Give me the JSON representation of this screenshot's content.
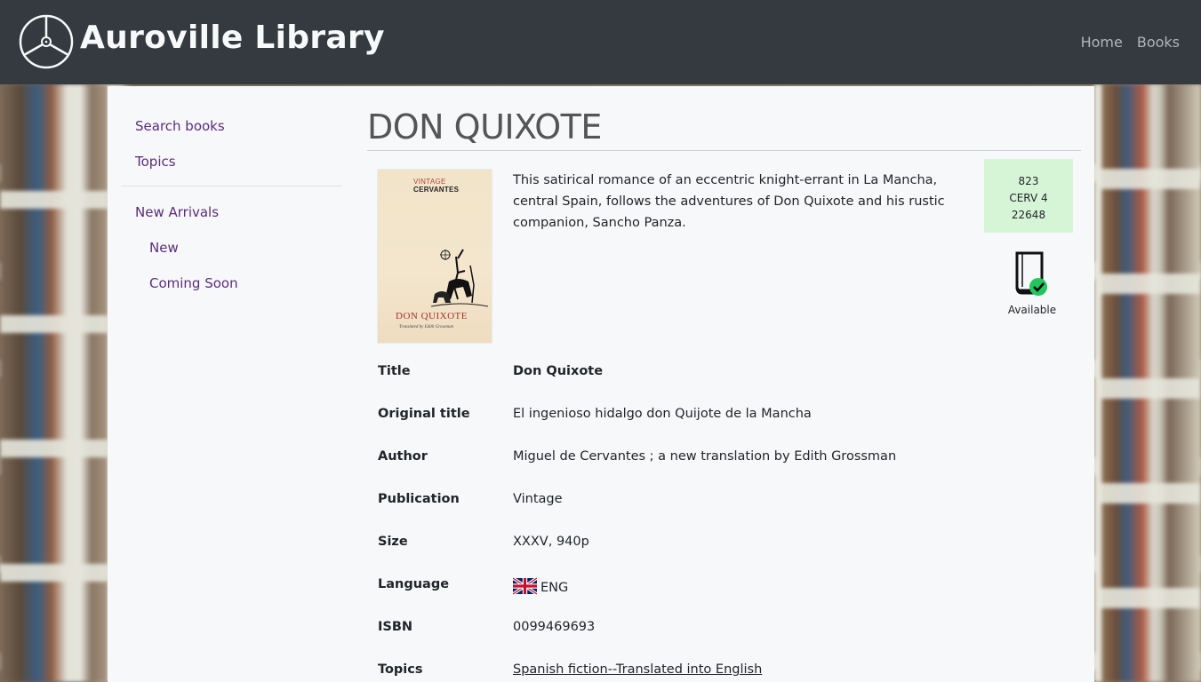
{
  "header": {
    "brand": "Auroville Library",
    "nav": [
      {
        "label": "Home"
      },
      {
        "label": "Books"
      }
    ]
  },
  "sidebar": {
    "items": [
      {
        "label": "Search books"
      },
      {
        "label": "Topics"
      },
      {
        "label": "New Arrivals"
      },
      {
        "label": "New"
      },
      {
        "label": "Coming Soon"
      }
    ]
  },
  "book": {
    "heading": "DON QUIXOTE",
    "cover": {
      "publisher_label": "VINTAGE",
      "author_label": "CERVANTES",
      "title": "DON QUIXOTE",
      "subtitle": "Translated by Edith Grossman"
    },
    "description": "This satirical romance of an eccentric knight-errant in La Mancha, central Spain, follows the adventures of Don Quixote and his rustic companion, Sancho Panza.",
    "call_number": [
      "823",
      "CERV 4",
      "22648"
    ],
    "availability": "Available",
    "details": [
      {
        "label": "Title",
        "value": "Don Quixote"
      },
      {
        "label": "Original title",
        "value": "El ingenioso hidalgo don Quijote de la Mancha"
      },
      {
        "label": "Author",
        "value": "Miguel de Cervantes ; a new translation by Edith Grossman"
      },
      {
        "label": "Publication",
        "value": "Vintage"
      },
      {
        "label": "Size",
        "value": "XXXV, 940p"
      },
      {
        "label": "Language",
        "value": "ENG"
      },
      {
        "label": "ISBN",
        "value": "0099469693"
      },
      {
        "label": "Topics",
        "value": "Spanish fiction--Translated into English"
      }
    ]
  },
  "colors": {
    "navbar": "#343a40",
    "link": "#5b2c7a",
    "call_number_bg": "#d6f5d6",
    "available_check": "#22c55e"
  }
}
